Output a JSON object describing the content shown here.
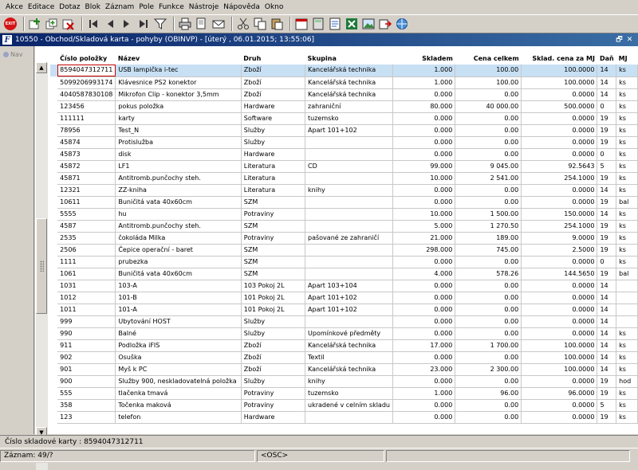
{
  "menu": [
    "Akce",
    "Editace",
    "Dotaz",
    "Blok",
    "Záznam",
    "Pole",
    "Funkce",
    "Nástroje",
    "Nápověda",
    "Okno"
  ],
  "toolbar": {
    "exit_label": "EXIT",
    "icons": [
      "exit-icon",
      "insert-record-icon",
      "duplicate-record-icon",
      "delete-record-icon",
      "first-record-icon",
      "previous-record-icon",
      "next-record-icon",
      "last-record-icon",
      "filter-icon",
      "print-icon",
      "print-preview-icon",
      "email-icon",
      "cut-icon",
      "copy-icon",
      "paste-icon",
      "calendar-icon",
      "calculator-icon",
      "document-icon",
      "excel-icon",
      "image-icon",
      "export-icon",
      "browser-icon"
    ]
  },
  "window": {
    "title": "10550 - Obchod/Skladová karta - pohyby (OBINVP) - [úterý  , 06.01.2015; 13:55:06]",
    "app_icon_letter": "F",
    "restore_label": "🗗",
    "close_label": "✕"
  },
  "nav": {
    "label": "Nav"
  },
  "grid": {
    "columns": [
      "Číslo položky",
      "Název",
      "Druh",
      "Skupina",
      "Skladem",
      "Cena celkem",
      "Sklad. cena za MJ",
      "Daň",
      "MJ"
    ],
    "rows": [
      [
        "8594047312711",
        "USB lampička i-tec",
        "Zboží",
        "Kancelářská technika",
        "1.000",
        "100.00",
        "100.0000",
        "14",
        "ks"
      ],
      [
        "5099206993174",
        "Klávesnice PS2 konektor",
        "Zboží",
        "Kancelářská technika",
        "1.000",
        "100.00",
        "100.0000",
        "14",
        "ks"
      ],
      [
        "4040587830108",
        "Mikrofon Clip - konektor 3,5mm",
        "Zboží",
        "Kancelářská technika",
        "0.000",
        "0.00",
        "0.0000",
        "14",
        "ks"
      ],
      [
        "123456",
        "pokus položka",
        "Hardware",
        "zahraniční",
        "80.000",
        "40 000.00",
        "500.0000",
        "0",
        "ks"
      ],
      [
        "111111",
        "karty",
        "Software",
        "tuzemsko",
        "0.000",
        "0.00",
        "0.0000",
        "19",
        "ks"
      ],
      [
        "78956",
        "Test_N",
        "Služby",
        "Apart 101+102",
        "0.000",
        "0.00",
        "0.0000",
        "19",
        "ks"
      ],
      [
        "45874",
        "Protislužba",
        "Služby",
        "",
        "0.000",
        "0.00",
        "0.0000",
        "19",
        "ks"
      ],
      [
        "45873",
        "disk",
        "Hardware",
        "",
        "0.000",
        "0.00",
        "0.0000",
        "0",
        "ks"
      ],
      [
        "45872",
        "LF1",
        "Literatura",
        "CD",
        "99.000",
        "9 045.00",
        "92.5643",
        "5",
        "ks"
      ],
      [
        "45871",
        "Antitromb.punčochy steh.",
        "Literatura",
        "",
        "10.000",
        "2 541.00",
        "254.1000",
        "19",
        "ks"
      ],
      [
        "12321",
        "ZZ-kniha",
        "Literatura",
        "knihy",
        "0.000",
        "0.00",
        "0.0000",
        "14",
        "ks"
      ],
      [
        "10611",
        "Buničitá vata 40x60cm",
        "SZM",
        "",
        "0.000",
        "0.00",
        "0.0000",
        "19",
        "bal"
      ],
      [
        "5555",
        "hu",
        "Potraviny",
        "",
        "10.000",
        "1 500.00",
        "150.0000",
        "14",
        "ks"
      ],
      [
        "4587",
        "Antitromb.punčochy steh.",
        "SZM",
        "",
        "5.000",
        "1 270.50",
        "254.1000",
        "19",
        "ks"
      ],
      [
        "2535",
        "čokoláda Milka",
        "Potraviny",
        "pašované ze zahraničí",
        "21.000",
        "189.00",
        "9.0000",
        "19",
        "ks"
      ],
      [
        "2506",
        "Čepice operační - baret",
        "SZM",
        "",
        "298.000",
        "745.00",
        "2.5000",
        "19",
        "ks"
      ],
      [
        "1111",
        "prubezka",
        "SZM",
        "",
        "0.000",
        "0.00",
        "0.0000",
        "0",
        "ks"
      ],
      [
        "1061",
        "Buničitá vata 40x60cm",
        "SZM",
        "",
        "4.000",
        "578.26",
        "144.5650",
        "19",
        "bal"
      ],
      [
        "1031",
        "103-A",
        "103 Pokoj 2L",
        "Apart 103+104",
        "0.000",
        "0.00",
        "0.0000",
        "14",
        ""
      ],
      [
        "1012",
        "101-B",
        "101 Pokoj 2L",
        "Apart 101+102",
        "0.000",
        "0.00",
        "0.0000",
        "14",
        ""
      ],
      [
        "1011",
        "101-A",
        "101 Pokoj 2L",
        "Apart 101+102",
        "0.000",
        "0.00",
        "0.0000",
        "14",
        ""
      ],
      [
        "999",
        "Ubytování HOST",
        "Služby",
        "",
        "0.000",
        "0.00",
        "0.0000",
        "14",
        ""
      ],
      [
        "990",
        "Balné",
        "Služby",
        "Upomínkové předměty",
        "0.000",
        "0.00",
        "0.0000",
        "14",
        "ks"
      ],
      [
        "911",
        "Podložka iFIS",
        "Zboží",
        "Kancelářská technika",
        "17.000",
        "1 700.00",
        "100.0000",
        "14",
        "ks"
      ],
      [
        "902",
        "Osuška",
        "Zboží",
        "Textil",
        "0.000",
        "0.00",
        "100.0000",
        "14",
        "ks"
      ],
      [
        "901",
        "Myš k PC",
        "Zboží",
        "Kancelářská technika",
        "23.000",
        "2 300.00",
        "100.0000",
        "14",
        "ks"
      ],
      [
        "900",
        "Služby 900, neskladovatelná položka",
        "Služby",
        "knihy",
        "0.000",
        "0.00",
        "0.0000",
        "19",
        "hod"
      ],
      [
        "555",
        "tlačenka tmavá",
        "Potraviny",
        "tuzemsko",
        "1.000",
        "96.00",
        "96.0000",
        "19",
        "ks"
      ],
      [
        "358",
        "Točenka maková",
        "Potraviny",
        "ukradené v celním skladu",
        "0.000",
        "0.00",
        "0.0000",
        "5",
        "ks"
      ],
      [
        "123",
        "telefon",
        "Hardware",
        "",
        "0.000",
        "0.00",
        "0.0000",
        "19",
        "ks"
      ]
    ]
  },
  "status": {
    "field_hint": "Číslo skladové karty : 8594047312711",
    "record": "Záznam: 49/?",
    "mode": "<OSC>"
  }
}
